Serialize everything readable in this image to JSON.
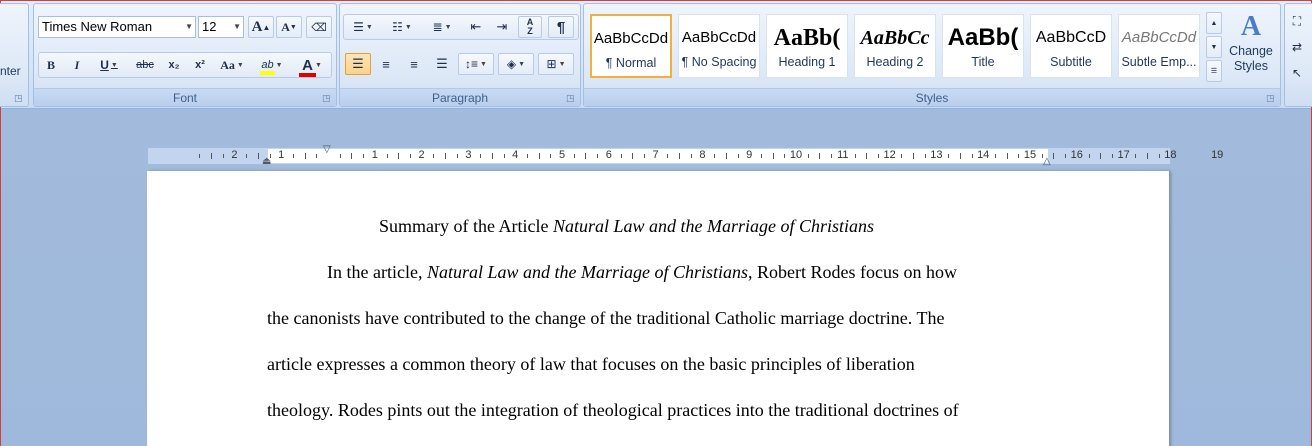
{
  "clipboard": {
    "partial_label": "nter"
  },
  "font": {
    "name": "Times New Roman",
    "size": "12",
    "group_label": "Font",
    "grow_label": "A",
    "shrink_label": "A",
    "bold": "B",
    "italic": "I",
    "underline": "U",
    "strike": "abc",
    "subscript": "x₂",
    "superscript": "x²",
    "change_case": "Aa",
    "highlight": "ab",
    "font_color": "A"
  },
  "paragraph": {
    "group_label": "Paragraph",
    "pilcrow": "¶"
  },
  "styles": {
    "group_label": "Styles",
    "items": [
      {
        "sample": "AaBbCcDd",
        "name": "¶ Normal"
      },
      {
        "sample": "AaBbCcDd",
        "name": "¶ No Spacing"
      },
      {
        "sample": "AaBb(",
        "name": "Heading 1"
      },
      {
        "sample": "AaBbCc",
        "name": "Heading 2"
      },
      {
        "sample": "AaBb(",
        "name": "Title"
      },
      {
        "sample": "AaBbCcD",
        "name": "Subtitle"
      },
      {
        "sample": "AaBbCcDd",
        "name": "Subtle Emp..."
      }
    ],
    "change_styles": "Change Styles"
  },
  "colors": {
    "highlight": "#ffff00",
    "font_color": "#e00000",
    "selected_border": "#f0b040"
  },
  "ruler": {
    "labels": [
      "2",
      "1",
      "1",
      "2",
      "3",
      "4",
      "5",
      "6",
      "7",
      "8",
      "9",
      "10",
      "11",
      "12",
      "13",
      "14",
      "15",
      "16",
      "17",
      "18",
      "19"
    ]
  },
  "document": {
    "title_plain": "Summary of the Article ",
    "title_italic": "Natural Law and the Marriage of Christians",
    "p1_start": "In the article, ",
    "p1_italic": "Natural Law and the Marriage of Christians",
    "p1_rest": ", Robert Rodes focus on how",
    "line2": "the canonists have contributed to the change of the traditional Catholic marriage doctrine. The",
    "line3": "article expresses a common theory of law that focuses on the basic principles of liberation",
    "line4": "theology. Rodes pints out the integration of theological practices into the traditional doctrines of"
  }
}
